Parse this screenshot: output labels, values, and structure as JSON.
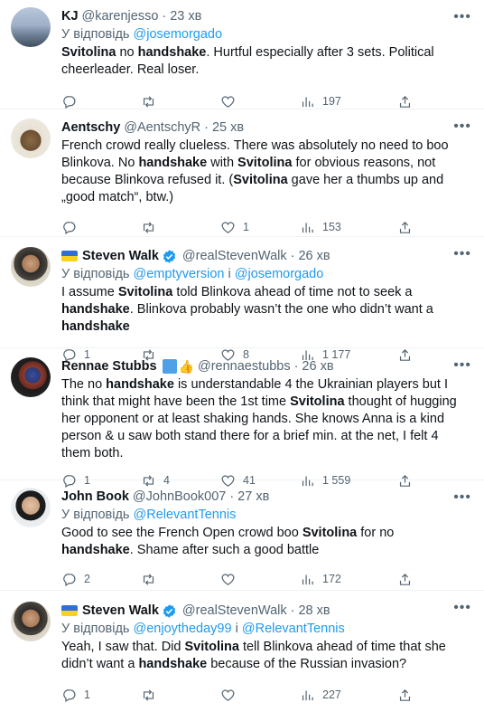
{
  "reply_prefix": "У відповідь",
  "tweets": [
    {
      "name": "KJ",
      "handle": "@karenjesso",
      "time": "23 хв",
      "reply_to": "@josemorgado",
      "reply_to_2": "",
      "text_html": "<b>Svitolina</b> no <b>handshake</b>. Hurtful especially after 3 sets. Political cheerleader. Real loser.",
      "counts": {
        "reply": "",
        "retweet": "",
        "like": "",
        "views": "197"
      }
    },
    {
      "name": "Aentschy",
      "handle": "@AentschyR",
      "time": "25 хв",
      "reply_to": "",
      "reply_to_2": "",
      "text_html": "French crowd really clueless. There was absolutely no need to boo Blinkova. No <b>handshake</b> with <b>Svitolina</b> for obvious reasons, not because Blinkova refused it. (<b>Svitolina</b> gave her a thumbs up and „good match“, btw.)",
      "counts": {
        "reply": "",
        "retweet": "",
        "like": "1",
        "views": "153"
      }
    },
    {
      "name": "Steven Walk",
      "handle": "@realStevenWalk",
      "time": "26 хв",
      "reply_to": "@emptyversion",
      "reply_to_2": "@josemorgado",
      "text_html": "I assume <b>Svitolina</b> told Blinkova ahead of time not to seek a <b>handshake</b>. Blinkova probably wasn’t the one who didn’t want a <b>handshake</b>",
      "counts": {
        "reply": "1",
        "retweet": "",
        "like": "8",
        "views": "1 177"
      }
    },
    {
      "name": "Rennae Stubbs",
      "handle": "@rennaestubbs",
      "time": "26 хв",
      "reply_to": "",
      "reply_to_2": "",
      "text_html": "The no <b>handshake</b> is understandable 4 the Ukrainian players but I think that might have been the 1st time <b>Svitolina</b> thought of hugging her opponent or at least shaking hands. She knows Anna is a kind person &amp; u saw both stand there for a brief min. at the net, I felt 4 them both.",
      "counts": {
        "reply": "1",
        "retweet": "4",
        "like": "41",
        "views": "1 559"
      }
    },
    {
      "name": "John Book",
      "handle": "@JohnBook007",
      "time": "27 хв",
      "reply_to": "@RelevantTennis",
      "reply_to_2": "",
      "text_html": "Good to see the French Open crowd boo <b>Svitolina</b> for no <b>handshake</b>. Shame after such a good battle",
      "counts": {
        "reply": "2",
        "retweet": "",
        "like": "",
        "views": "172"
      }
    },
    {
      "name": "Steven Walk",
      "handle": "@realStevenWalk",
      "time": "28 хв",
      "reply_to": "@enjoytheday99",
      "reply_to_2": "@RelevantTennis",
      "text_html": "Yeah, I saw that. Did <b>Svitolina</b> tell Blinkova ahead of time that she didn’t want a <b>handshake</b> because of the Russian invasion?",
      "counts": {
        "reply": "1",
        "retweet": "",
        "like": "",
        "views": "227"
      }
    }
  ],
  "icons": {
    "reply": "reply-icon",
    "retweet": "retweet-icon",
    "like": "like-icon",
    "views": "views-icon",
    "share": "share-icon",
    "more": "more-icon",
    "verified": "verified-icon",
    "flag": "ukraine-flag-icon"
  },
  "colors": {
    "link": "#1d9bf0",
    "muted": "#536471",
    "text": "#0f1419"
  }
}
